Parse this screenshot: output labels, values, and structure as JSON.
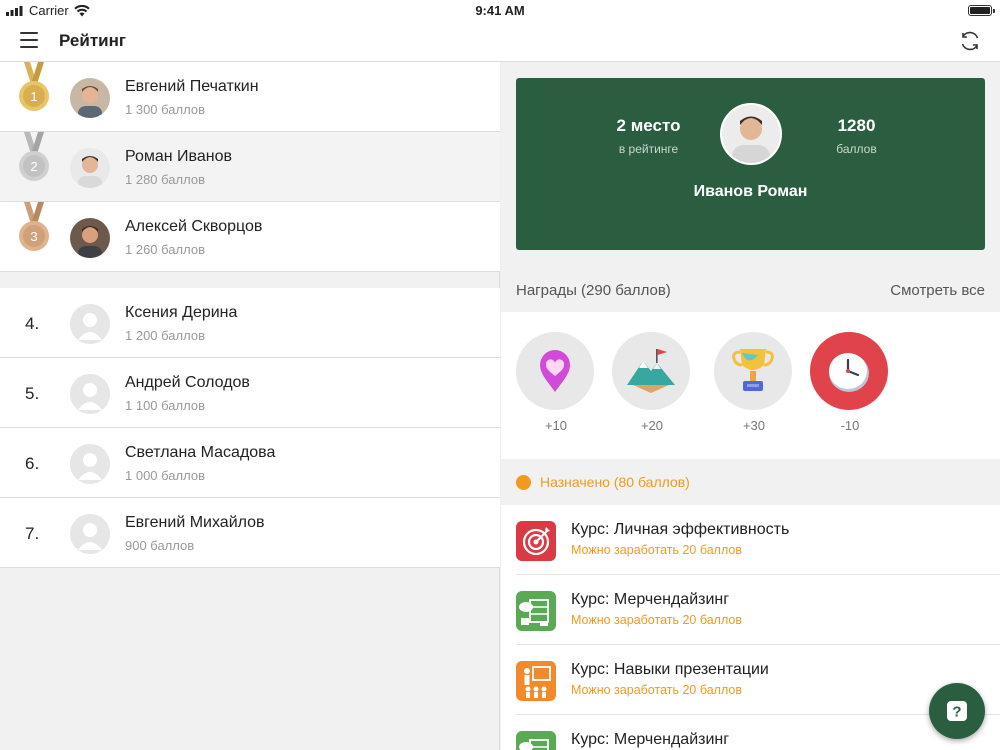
{
  "status_bar": {
    "carrier": "Carrier",
    "time": "9:41 AM"
  },
  "nav": {
    "title": "Рейтинг"
  },
  "leaderboard": [
    {
      "rank": "1",
      "name": "Евгений Печаткин",
      "score": "1 300 баллов",
      "medal": "gold",
      "avatar": "photo"
    },
    {
      "rank": "2",
      "name": "Роман Иванов",
      "score": "1 280 баллов",
      "medal": "silver",
      "avatar": "photo"
    },
    {
      "rank": "3",
      "name": "Алексей Скворцов",
      "score": "1 260 баллов",
      "medal": "bronze",
      "avatar": "photo"
    },
    {
      "rank": "4.",
      "name": "Ксения Дерина",
      "score": "1 200 баллов",
      "avatar": "placeholder"
    },
    {
      "rank": "5.",
      "name": "Андрей Солодов",
      "score": "1 100 баллов",
      "avatar": "placeholder"
    },
    {
      "rank": "6.",
      "name": "Светлана Масадова",
      "score": "1 000 баллов",
      "avatar": "placeholder"
    },
    {
      "rank": "7.",
      "name": "Евгений Михайлов",
      "score": "900 баллов",
      "avatar": "placeholder"
    }
  ],
  "profile": {
    "place": "2 место",
    "place_caption": "в рейтинге",
    "points": "1280",
    "points_caption": "баллов",
    "name": "Иванов Роман",
    "color": "#2b5e41"
  },
  "awards": {
    "title": "Награды (290 баллов)",
    "see_all": "Смотреть все",
    "items": [
      {
        "icon": "heart-pin-icon",
        "value": "+10"
      },
      {
        "icon": "mountain-flag-icon",
        "value": "+20"
      },
      {
        "icon": "trophy-icon",
        "value": "+30"
      },
      {
        "icon": "clock-icon",
        "value": "-10"
      }
    ]
  },
  "assigned": {
    "title": "Назначено (80 баллов)",
    "color": "#f29a1e",
    "courses": [
      {
        "title": "Курс: Личная эффективность",
        "subtitle": "Можно заработать 20 баллов",
        "icon": "target-icon"
      },
      {
        "title": "Курс: Мерчендайзинг",
        "subtitle": "Можно заработать 20 баллов",
        "icon": "shelf-icon"
      },
      {
        "title": "Курс: Навыки презентации",
        "subtitle": "Можно заработать 20 баллов",
        "icon": "presentation-icon"
      },
      {
        "title": "Курс: Мерчендайзинг",
        "subtitle": "",
        "icon": "shelf-icon"
      }
    ]
  },
  "help": {
    "label": "?"
  }
}
